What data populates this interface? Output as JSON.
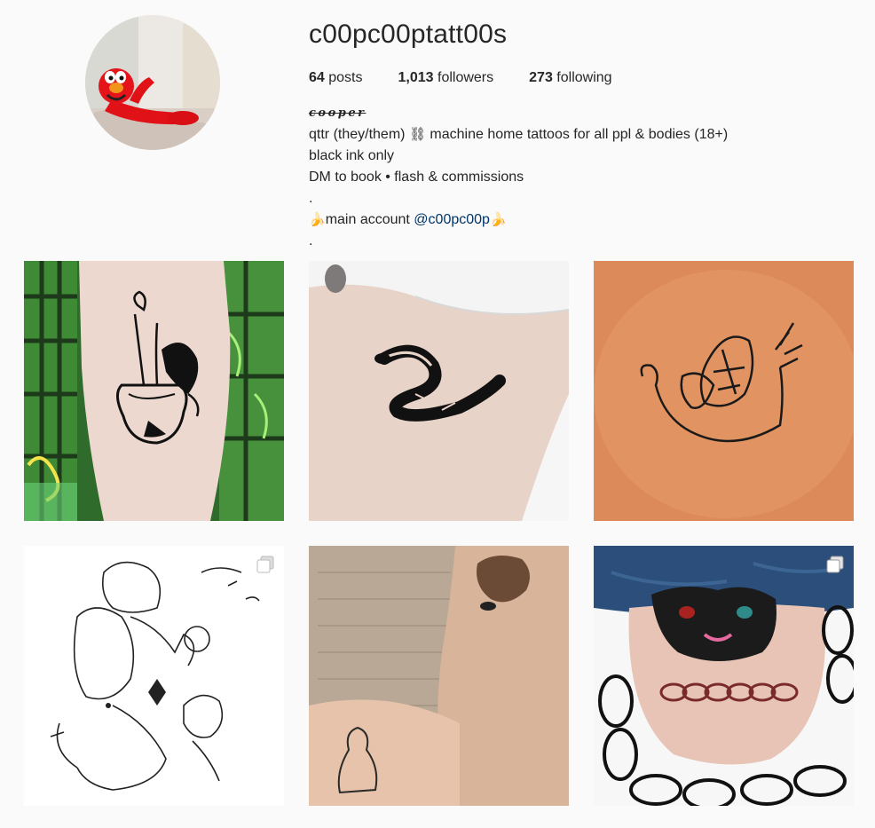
{
  "profile": {
    "username": "c00pc00ptatt00s",
    "avatar_icon": "profile-photo-red-puppet",
    "stats": {
      "posts_count": "64",
      "posts_label": "posts",
      "followers_count": "1,013",
      "followers_label": "followers",
      "following_count": "273",
      "following_label": "following"
    },
    "bio": {
      "name": "cooper",
      "line1_text": "qttr (they/them)",
      "line1_emoji": "⛓",
      "line1_rest": " machine home tattoos for all ppl & bodies (18+)",
      "line2": "black ink only",
      "line3": "DM to book • flash & commissions",
      "line4": ".",
      "line5_emoji_left": "🍌",
      "line5_text": "main account ",
      "line5_link": "@c00pc00p",
      "line5_emoji_right": "🍌",
      "line6": "."
    }
  },
  "posts": [
    {
      "icon": "forearm-vase-flower-tattoo",
      "multi": false
    },
    {
      "icon": "ribcage-snake-tattoo",
      "multi": false
    },
    {
      "icon": "teapot-leaf-linework-tattoo",
      "multi": false
    },
    {
      "icon": "line-drawing-flash-sheet",
      "multi": true
    },
    {
      "icon": "arm-figure-tattoo",
      "multi": false
    },
    {
      "icon": "thigh-panther-chain-tattoo",
      "multi": true
    }
  ],
  "colors": {
    "background": "#fafafa",
    "text": "#262626",
    "link": "#003569"
  }
}
